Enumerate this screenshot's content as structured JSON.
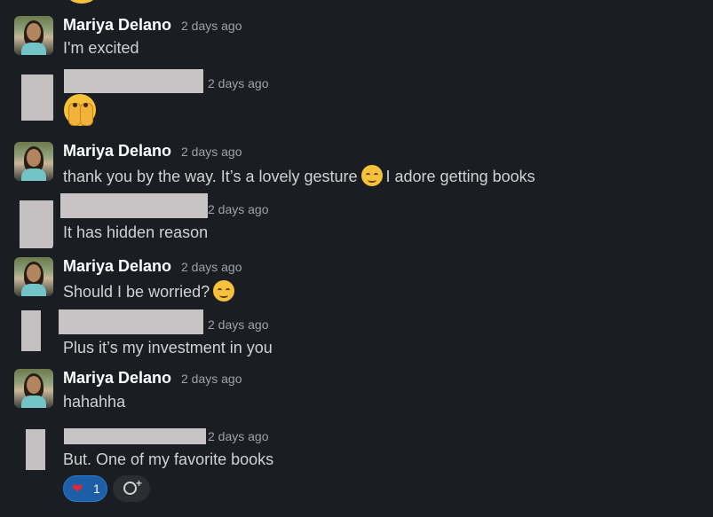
{
  "messages": [
    {
      "author": "Mariya Delano",
      "time": "2 days ago",
      "text": "I'm excited"
    },
    {
      "author": "",
      "time": "2 days ago",
      "text": ""
    },
    {
      "author": "Mariya Delano",
      "time": "2 days ago",
      "text_before": "thank you by the way. It’s a lovely gesture",
      "text_after": "I adore getting books"
    },
    {
      "author": "",
      "time": "2 days ago",
      "text": "It has hidden reason"
    },
    {
      "author": "Mariya Delano",
      "time": "2 days ago",
      "text": "Should I be worried?"
    },
    {
      "author": "",
      "time": "2 days ago",
      "text": "Plus it’s my investment in you"
    },
    {
      "author": "Mariya Delano",
      "time": "2 days ago",
      "text": "hahahha"
    },
    {
      "author": "",
      "time": "2 days ago",
      "text": "But. One of my favorite books"
    }
  ],
  "reaction": {
    "emoji": "❤",
    "count": "1"
  },
  "icons": {
    "heart": "heart-icon",
    "add_reaction": "add-reaction-icon",
    "see_no_evil": "see-no-evil-emoji",
    "smiling_face": "smiling-face-emoji",
    "tears_of_joy": "tears-of-joy-emoji"
  },
  "colors": {
    "background": "#1a1d21",
    "text": "#d1d2d3",
    "timestamp": "#a0a2a5",
    "reaction_bg": "#1c5ea8"
  }
}
